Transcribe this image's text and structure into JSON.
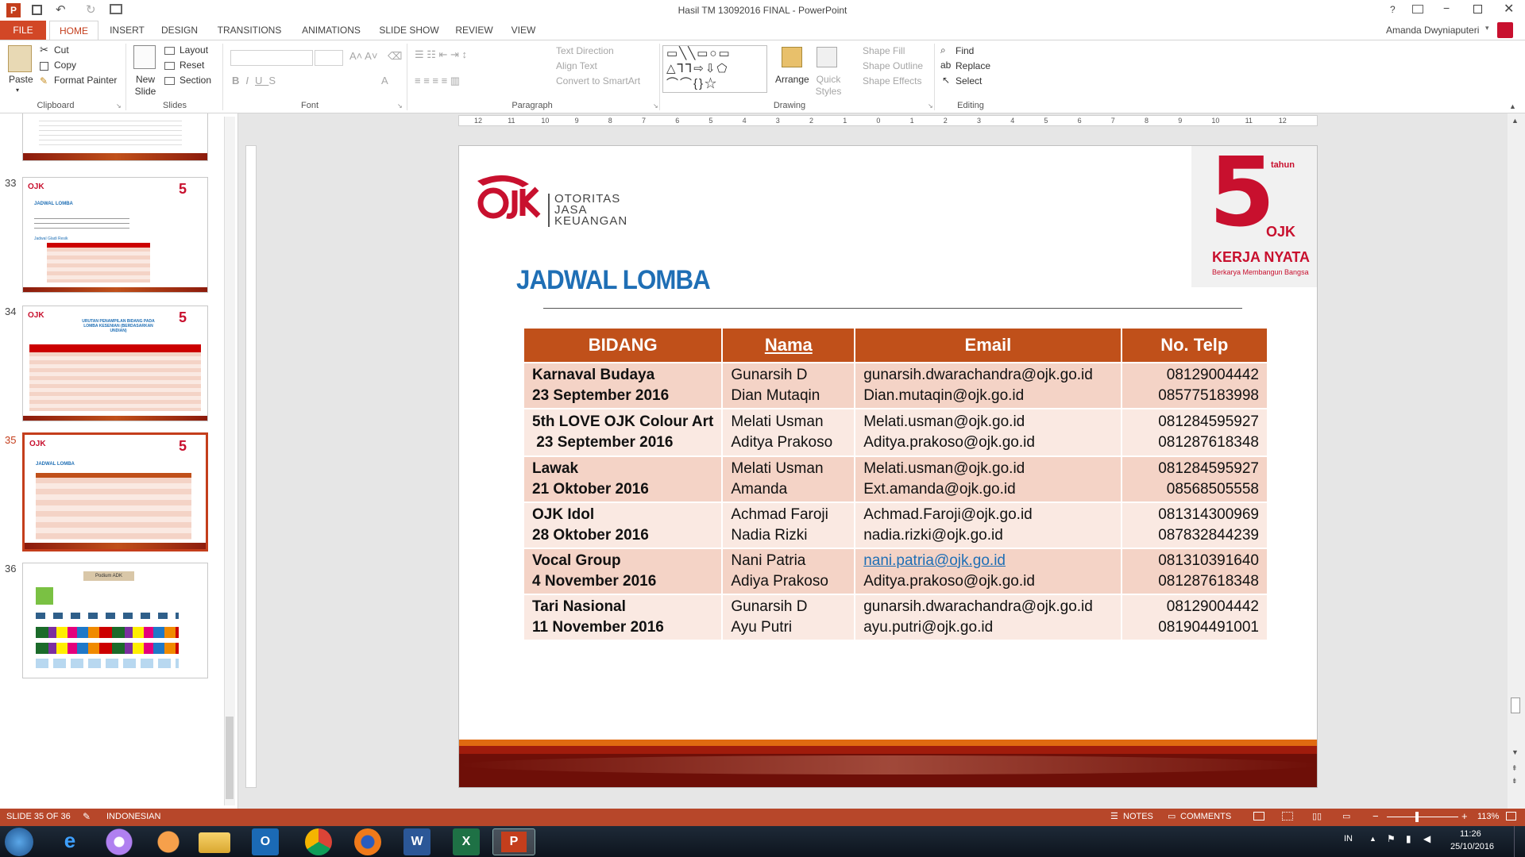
{
  "window": {
    "title": "Hasil TM 13092016 FINAL - PowerPoint",
    "user": "Amanda Dwyniaputeri",
    "help": "?"
  },
  "ribbon_tabs": [
    "FILE",
    "HOME",
    "INSERT",
    "DESIGN",
    "TRANSITIONS",
    "ANIMATIONS",
    "SLIDE SHOW",
    "REVIEW",
    "VIEW"
  ],
  "clipboard": {
    "paste": "Paste",
    "cut": "Cut",
    "copy": "Copy",
    "format_painter": "Format Painter",
    "label": "Clipboard"
  },
  "slides_group": {
    "new_slide": "New Slide",
    "layout": "Layout",
    "reset": "Reset",
    "section": "Section",
    "label": "Slides"
  },
  "font_group": {
    "label": "Font"
  },
  "paragraph_group": {
    "text_direction": "Text Direction",
    "align_text": "Align Text",
    "convert": "Convert to SmartArt",
    "label": "Paragraph"
  },
  "drawing_group": {
    "arrange": "Arrange",
    "quick_styles": "Quick Styles",
    "shape_fill": "Shape Fill",
    "shape_outline": "Shape Outline",
    "shape_effects": "Shape Effects",
    "label": "Drawing"
  },
  "editing_group": {
    "find": "Find",
    "replace": "Replace",
    "select": "Select",
    "label": "Editing"
  },
  "ruler_labels": [
    "12",
    "11",
    "10",
    "9",
    "8",
    "7",
    "6",
    "5",
    "4",
    "3",
    "2",
    "1",
    "0",
    "1",
    "2",
    "3",
    "4",
    "5",
    "6",
    "7",
    "8",
    "9",
    "10",
    "11",
    "12"
  ],
  "thumbnails": [
    {
      "num": "33",
      "title": "JADWAL LOMBA",
      "sub": "Jadwal Gladi Resik"
    },
    {
      "num": "34",
      "title": "URUTAN PENAMPILAN BIDANG PADA LOMBA KESENIAN (BERDASARKAN UNDIAN)"
    },
    {
      "num": "35",
      "title": "JADWAL LOMBA"
    },
    {
      "num": "36",
      "title": "Podium ADK"
    }
  ],
  "slide": {
    "logo": {
      "org1": "OTORITAS",
      "org2": "JASA",
      "org3": "KEUANGAN",
      "mark": "OJK"
    },
    "badge": {
      "tahun": "tahun",
      "num": "5",
      "kerja": "KERJA NYATA",
      "tagline": "Berkarya Membangun Bangsa"
    },
    "title": "JADWAL LOMBA",
    "headers": [
      "BIDANG",
      "Nama",
      "Email",
      "No. Telp"
    ],
    "rows": [
      {
        "bidang": [
          "Karnaval Budaya",
          "23 September 2016"
        ],
        "nama": [
          "Gunarsih D",
          "Dian Mutaqin"
        ],
        "email": [
          "gunarsih.dwarachandra@ojk.go.id",
          "Dian.mutaqin@ojk.go.id"
        ],
        "telp": [
          "08129004442",
          "085775183998"
        ]
      },
      {
        "bidang": [
          "5th LOVE OJK Colour Art",
          " 23 September 2016"
        ],
        "nama": [
          "Melati Usman",
          "Aditya Prakoso"
        ],
        "email": [
          "Melati.usman@ojk.go.id",
          "Aditya.prakoso@ojk.go.id"
        ],
        "telp": [
          "081284595927",
          "081287618348"
        ]
      },
      {
        "bidang": [
          "Lawak",
          "21 Oktober 2016"
        ],
        "nama": [
          "Melati Usman",
          "Amanda"
        ],
        "email": [
          "Melati.usman@ojk.go.id",
          "Ext.amanda@ojk.go.id"
        ],
        "telp": [
          "081284595927",
          "08568505558"
        ]
      },
      {
        "bidang": [
          "OJK Idol",
          "28 Oktober 2016"
        ],
        "nama": [
          "Achmad Faroji",
          "Nadia Rizki"
        ],
        "email": [
          "Achmad.Faroji@ojk.go.id",
          "nadia.rizki@ojk.go.id"
        ],
        "telp": [
          "081314300969",
          "087832844239"
        ]
      },
      {
        "bidang": [
          "Vocal Group",
          "4 November 2016"
        ],
        "nama": [
          "Nani Patria",
          "Adiya Prakoso"
        ],
        "email": [
          "nani.patria@ojk.go.id",
          "Aditya.prakoso@ojk.go.id"
        ],
        "telp": [
          "081310391640",
          "081287618348"
        ]
      },
      {
        "bidang": [
          "Tari Nasional",
          "11 November 2016"
        ],
        "nama": [
          "Gunarsih D",
          "Ayu Putri"
        ],
        "email": [
          "gunarsih.dwarachandra@ojk.go.id",
          "ayu.putri@ojk.go.id"
        ],
        "telp": [
          "08129004442",
          "081904491001"
        ]
      }
    ]
  },
  "status": {
    "slide": "SLIDE 35 OF 36",
    "language": "INDONESIAN",
    "notes": "NOTES",
    "comments": "COMMENTS",
    "zoom": "113%"
  },
  "taskbar": {
    "lang": "IN",
    "time": "11:26",
    "date": "25/10/2016"
  },
  "colors": {
    "accent": "#b7472a",
    "header_fill": "#c0501a",
    "title_blue": "#1f6fb5",
    "row_dark": "#f4d3c6",
    "row_light": "#fae9e2"
  }
}
